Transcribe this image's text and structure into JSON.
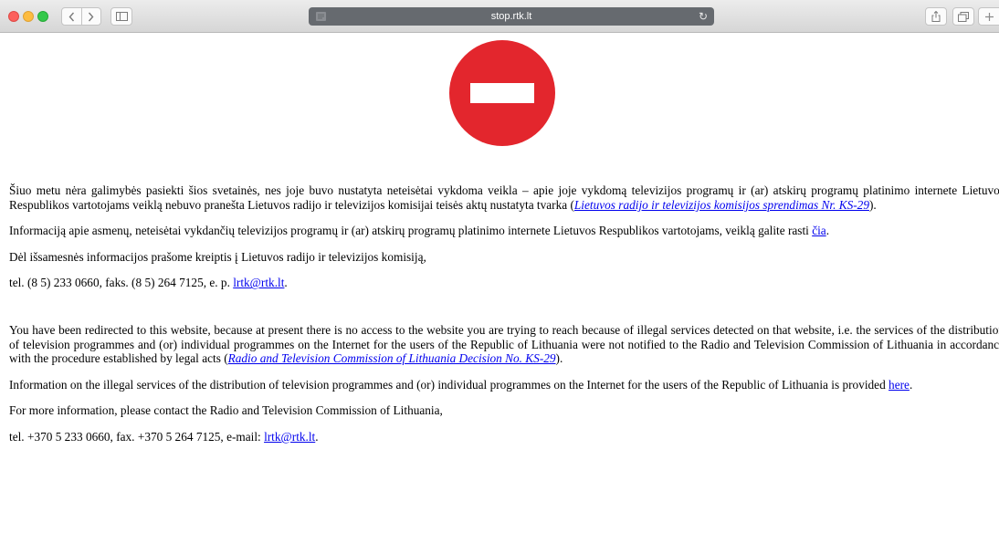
{
  "browser": {
    "url": "stop.rtk.lt",
    "reload_glyph": "↻",
    "icons": {
      "back": "chevron-left-icon",
      "forward": "chevron-right-icon",
      "sidebar": "sidebar-icon",
      "reader": "reader-icon",
      "reload": "reload-icon",
      "share": "share-icon",
      "tabs": "tabs-overview-icon",
      "new_tab": "plus-icon"
    },
    "colors": {
      "close": "#fc605c",
      "minimize": "#fdbc40",
      "maximize": "#34c84a",
      "address_bar": "#666a6f"
    }
  },
  "page": {
    "stop_sign": {
      "icon": "stop-sign-icon",
      "color": "#e3262d"
    },
    "link_color": "#0000ee",
    "lt": {
      "p1_text": "Šiuo metu nėra galimybės pasiekti šios svetainės, nes joje buvo nustatyta neteisėtai vykdoma veikla – apie joje vykdomą televizijos programų ir (ar) atskirų programų platinimo internete Lietuvos Respublikos vartotojams veiklą nebuvo pranešta Lietuvos radijo ir televizijos komisijai teisės aktų nustatyta tvarka (",
      "p1_link": "Lietuvos radijo ir televizijos komisijos sprendimas Nr. KS-29",
      "p1_end": ").",
      "p2_text": "Informaciją apie asmenų, neteisėtai vykdančių televizijos programų ir (ar) atskirų programų platinimo internete Lietuvos Respublikos vartotojams, veiklą galite rasti ",
      "p2_link": "čia",
      "p2_end": ".",
      "p3_text": "Dėl išsamesnės informacijos prašome kreiptis į Lietuvos radijo ir televizijos komisiją,",
      "p4_text": "tel. (8 5) 233 0660, faks. (8 5) 264 7125, e. p. ",
      "p4_link": "lrtk@rtk.lt",
      "p4_end": "."
    },
    "en": {
      "p1_text": "You have been redirected to this website, because at present there is no access to the website you are trying to reach because of illegal services detected on that website, i.e. the services of the distribution of television programmes and (or) individual programmes on the Internet for the users of the Republic of Lithuania were not notified to the Radio and Television Commission of Lithuania in accordance with the procedure established by legal acts (",
      "p1_link": "Radio and Television Commission of Lithuania Decision No. KS-29",
      "p1_end": ").",
      "p2_text": "Information on the illegal services of the distribution of television programmes and (or) individual programmes on the Internet for the users of the Republic of Lithuania is provided ",
      "p2_link": "here",
      "p2_end": ".",
      "p3_text": "For more information, please contact the Radio and Television Commission of Lithuania,",
      "p4_text": "tel. +370 5 233 0660, fax. +370 5 264 7125, e-mail: ",
      "p4_link": "lrtk@rtk.lt",
      "p4_end": "."
    }
  }
}
